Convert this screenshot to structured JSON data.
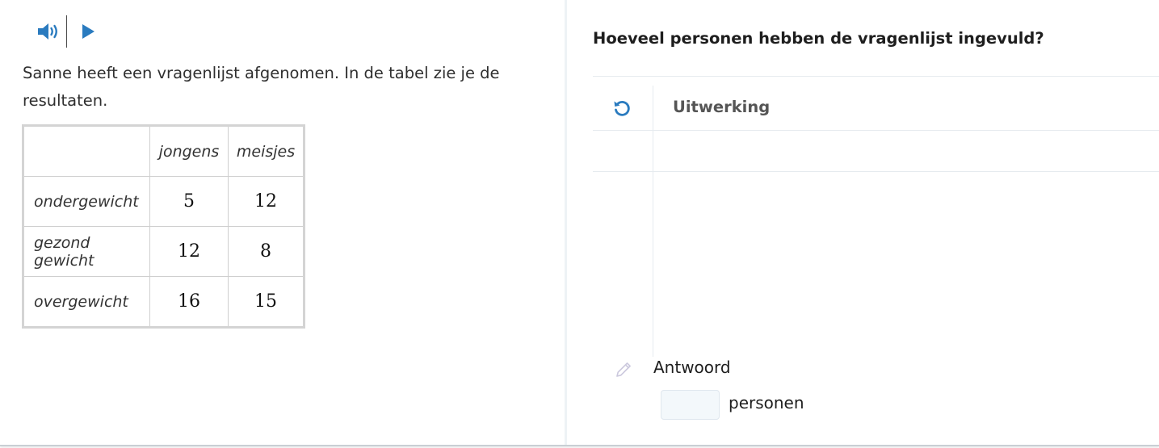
{
  "audio": {
    "speaker_icon": "speaker-volume-icon",
    "play_icon": "play-icon",
    "accent": "#2a7bbf"
  },
  "left": {
    "intro": "Sanne heeft een vragenlijst afgenomen. In de tabel zie je de resultaten.",
    "table": {
      "headers": [
        "",
        "jongens",
        "meisjes"
      ],
      "rows": [
        {
          "label": "ondergewicht",
          "values": [
            "5",
            "12"
          ]
        },
        {
          "label": "gezond gewicht",
          "values": [
            "12",
            "8"
          ]
        },
        {
          "label": "overgewicht",
          "values": [
            "16",
            "15"
          ]
        }
      ]
    }
  },
  "right": {
    "question": "Hoeveel personen hebben de vragenlijst ingevuld?",
    "worksheet_label": "Uitwerking",
    "reset_icon": "reset-icon",
    "answer_label": "Antwoord",
    "pencil_icon": "pencil-icon",
    "answer_value": "",
    "answer_placeholder": "",
    "answer_unit": "personen"
  }
}
